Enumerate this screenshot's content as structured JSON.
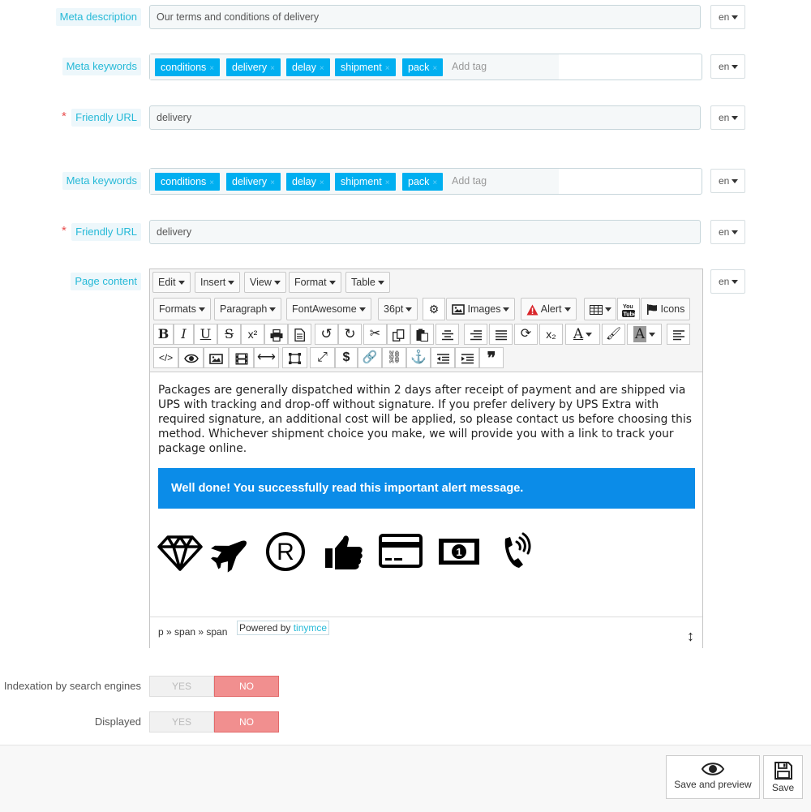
{
  "fields": {
    "meta_description": {
      "label": "Meta description",
      "value": "Our terms and conditions of delivery",
      "lang": "en"
    },
    "meta_keywords_1": {
      "label": "Meta keywords",
      "tags": [
        "conditions",
        "delivery",
        "delay",
        "shipment",
        "pack"
      ],
      "placeholder": "Add tag",
      "lang": "en"
    },
    "friendly_url_1": {
      "required": "*",
      "label": "Friendly URL",
      "value": "delivery",
      "lang": "en"
    },
    "meta_keywords_2": {
      "label": "Meta keywords",
      "tags": [
        "conditions",
        "delivery",
        "delay",
        "shipment",
        "pack"
      ],
      "placeholder": "Add tag",
      "lang": "en"
    },
    "friendly_url_2": {
      "required": "*",
      "label": "Friendly URL",
      "value": "delivery",
      "lang": "en"
    },
    "page_content": {
      "label": "Page content",
      "lang": "en"
    }
  },
  "editor": {
    "menus": [
      "Edit",
      "Insert",
      "View",
      "Format",
      "Table"
    ],
    "toolbar": {
      "formats": "Formats",
      "paragraph": "Paragraph",
      "fontawesome": "FontAwesome",
      "fontsize": "36pt",
      "images": "Images",
      "alert": "Alert",
      "icons": "Icons"
    },
    "content": {
      "paragraph": "Packages are generally dispatched within 2 days after receipt of payment and are shipped via UPS with tracking and drop-off without signature. If you prefer delivery by UPS Extra with required signature, an additional cost will be applied, so please contact us before choosing this method. Whichever shipment choice you make, we will provide you with a link to track your package online.",
      "alert": "Well done! You successfully read this important alert message.",
      "icons": [
        "diamond-icon",
        "plane-icon",
        "registered-icon",
        "thumbs-up-icon",
        "credit-card-icon",
        "money-icon",
        "phone-volume-icon"
      ]
    },
    "statusbar": {
      "path": "p » span » span",
      "powered_by": "Powered by",
      "powered_link": "tinymce"
    }
  },
  "toggles": {
    "indexation": {
      "label": "Indexation by search engines",
      "yes": "YES",
      "no": "NO",
      "selected": "NO"
    },
    "displayed": {
      "label": "Displayed",
      "yes": "YES",
      "no": "NO",
      "selected": "NO"
    }
  },
  "footer": {
    "save_preview": "Save and preview",
    "save": "Save"
  }
}
